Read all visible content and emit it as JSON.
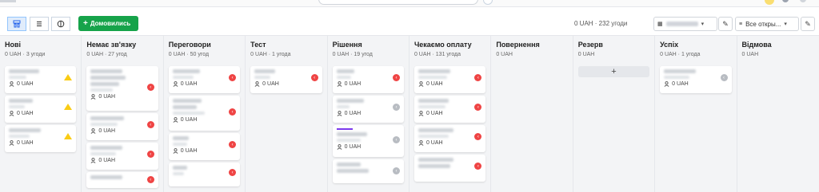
{
  "toolbar": {
    "add_label": "Домовились",
    "summary": "0 UAH · 232 угоди",
    "filter_label": "Все откры...",
    "view_icons": [
      "kanban-icon",
      "list-icon",
      "stats-icon"
    ]
  },
  "columns": [
    {
      "title": "Нові",
      "sub": "0 UAH · 3 угоди"
    },
    {
      "title": "Немає зв'язку",
      "sub": "0 UAH · 27 угод"
    },
    {
      "title": "Переговори",
      "sub": "0 UAH · 50 угод"
    },
    {
      "title": "Тест",
      "sub": "0 UAH · 1 угода"
    },
    {
      "title": "Рішення",
      "sub": "0 UAH · 19 угод"
    },
    {
      "title": "Чекаємо оплату",
      "sub": "0 UAH · 131 угода"
    },
    {
      "title": "Повернення",
      "sub": "0 UAH"
    },
    {
      "title": "Резерв",
      "sub": "0 UAH"
    },
    {
      "title": "Успіх",
      "sub": "0 UAH · 1 угода"
    },
    {
      "title": "Відмова",
      "sub": "0 UAH"
    }
  ],
  "card_amount": "0 UAH",
  "add_card_symbol": "+",
  "colors": {
    "accent_green": "#16a34a",
    "status_red": "#ef4444",
    "warning": "#facc15"
  }
}
